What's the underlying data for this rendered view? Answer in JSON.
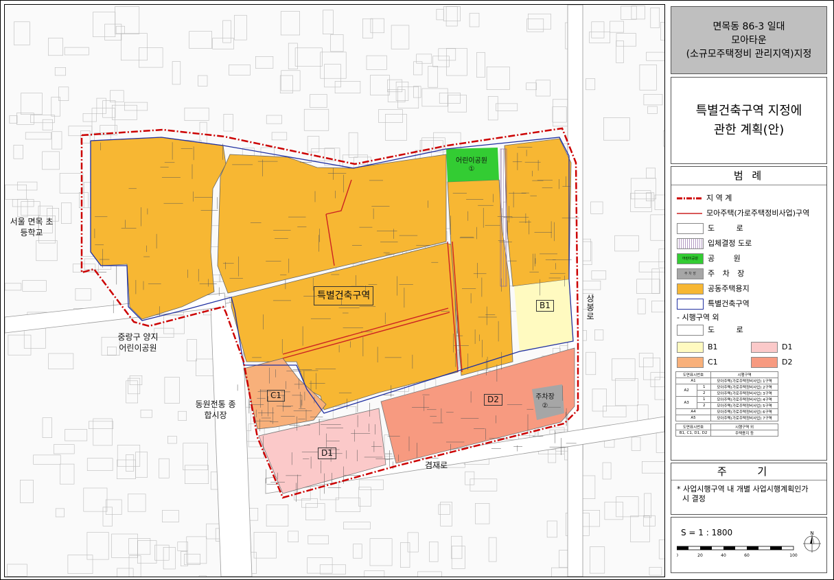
{
  "title": {
    "line1": "면목동 86-3 일대",
    "line2": "모아타운",
    "line3": "(소규모주택정비 관리지역)지정"
  },
  "subtitle": {
    "line1": "특별건축구역 지정에",
    "line2": "관한 계획(안)"
  },
  "map_labels": {
    "school": "서울 면목 초등학교",
    "park_yangji": "중랑구 양지 어린이공원",
    "market": "동원전통 종합시장",
    "special_zone": "특별건축구역",
    "kids_park": "어린이공원",
    "kids_park_no": "①",
    "parking": "주차장",
    "parking_no": "②",
    "road_bottom": "겸재로",
    "road_right": "상봉로",
    "b1": "B1",
    "c1": "C1",
    "d1": "D1",
    "d2": "D2"
  },
  "legend": {
    "title": "범 례",
    "items": [
      {
        "label": "지 역 계"
      },
      {
        "label": "모아주택(가로주택정비사업)구역"
      },
      {
        "label": "도 로"
      },
      {
        "label": "입체결정 도로"
      },
      {
        "label": "공 원",
        "swatch_text": "어린이공원"
      },
      {
        "label": "주 차 장",
        "swatch_text": "주 차 장"
      },
      {
        "label": "공동주택용지"
      },
      {
        "label": "특별건축구역"
      }
    ],
    "outside_title": "- 시행구역 외",
    "outside_road": "도 로",
    "outside": [
      {
        "label": "B1"
      },
      {
        "label": "D1"
      },
      {
        "label": "C1"
      },
      {
        "label": "D2"
      }
    ],
    "table": {
      "header": [
        "도면표시번호",
        "시행구역"
      ],
      "rows": [
        [
          "A1",
          "",
          "모아주택(가로주택정비사업) 1구역"
        ],
        [
          "A2",
          "1",
          "모아주택(가로주택정비사업) 2구역"
        ],
        [
          "",
          "2",
          "모아주택(가로주택정비사업) 3구역"
        ],
        [
          "A3",
          "1",
          "모아주택(가로주택정비사업) 4구역"
        ],
        [
          "",
          "2",
          "모아주택(가로주택정비사업) 5구역"
        ],
        [
          "A4",
          "",
          "모아주택(가로주택정비사업) 6구역"
        ],
        [
          "A5",
          "",
          "모아주택(가로주택정비사업) 7구역"
        ]
      ],
      "footer_header": [
        "도면표시번호",
        "시행구역 외"
      ],
      "footer_row": [
        "B1, C1, D1, D2",
        "주택용지 등"
      ]
    }
  },
  "notes": {
    "title": "주 기",
    "text1": "* 사업시행구역 내 개별 사업시행계획인가",
    "text2": "시 결정"
  },
  "scale": {
    "text": "S = 1 : 1800",
    "ticks": [
      "0",
      "20",
      "40",
      "60",
      "100"
    ],
    "north": "N"
  },
  "colors": {
    "housing": "#f7b733",
    "park": "#33cc33",
    "parking": "#a6a6a6",
    "b1": "#fffac0",
    "c1": "#f8b07a",
    "d1": "#fbc9c9",
    "d2": "#f79a80",
    "boundary": "#cc0000",
    "special": "#1f2fa0",
    "title_bg": "#bfbfbf"
  }
}
